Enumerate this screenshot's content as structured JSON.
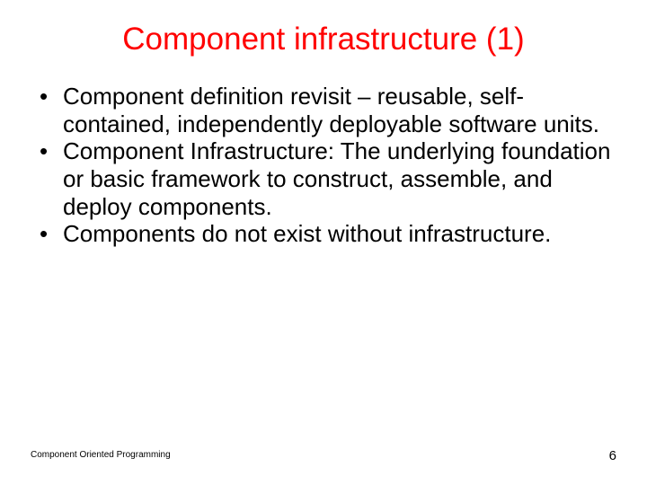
{
  "title": {
    "text": "Component infrastructure (1)",
    "color": "#ff0000"
  },
  "bullets": [
    "Component definition revisit – reusable, self-contained, independently deployable software units.",
    "Component Infrastructure: The underlying foundation or basic framework to construct, assemble, and deploy components.",
    "Components do not exist without infrastructure."
  ],
  "footer": {
    "left": "Component Oriented Programming",
    "page_number": "6"
  }
}
